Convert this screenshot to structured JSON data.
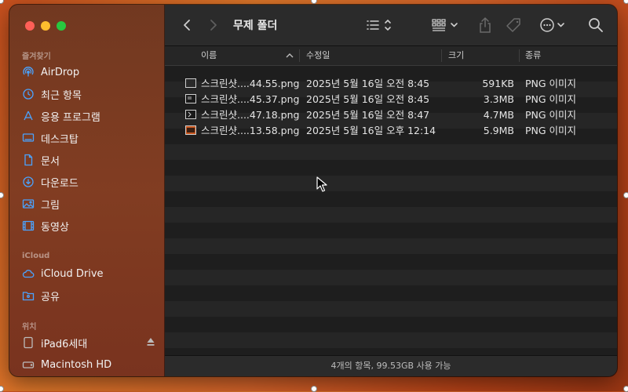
{
  "sidebar": {
    "sections": {
      "favorites": "즐겨찾기",
      "icloud": "iCloud",
      "locations": "위치"
    },
    "favorites": [
      {
        "label": "AirDrop",
        "icon": "airdrop-icon"
      },
      {
        "label": "최근 항목",
        "icon": "clock-icon"
      },
      {
        "label": "응용 프로그램",
        "icon": "applications-icon"
      },
      {
        "label": "데스크탑",
        "icon": "desktop-icon"
      },
      {
        "label": "문서",
        "icon": "document-icon"
      },
      {
        "label": "다운로드",
        "icon": "download-icon"
      },
      {
        "label": "그림",
        "icon": "pictures-icon"
      },
      {
        "label": "동영상",
        "icon": "movies-icon"
      }
    ],
    "icloud": [
      {
        "label": "iCloud Drive",
        "icon": "cloud-icon"
      },
      {
        "label": "공유",
        "icon": "shared-folder-icon"
      }
    ],
    "locations": [
      {
        "label": "iPad6세대",
        "icon": "ipad-icon"
      },
      {
        "label": "Macintosh HD",
        "icon": "harddrive-icon"
      }
    ]
  },
  "toolbar": {
    "title": "무제 폴더"
  },
  "columns": {
    "name": "이름",
    "modified": "수정일",
    "size": "크기",
    "kind": "종류"
  },
  "files": [
    {
      "name": "스크린샷....44.55.png",
      "modified": "2025년 5월 16일 오전 8:45",
      "size": "591KB",
      "kind": "PNG 이미지"
    },
    {
      "name": "스크린샷....45.37.png",
      "modified": "2025년 5월 16일 오전 8:45",
      "size": "3.3MB",
      "kind": "PNG 이미지"
    },
    {
      "name": "스크린샷....47.18.png",
      "modified": "2025년 5월 16일 오전 8:47",
      "size": "4.7MB",
      "kind": "PNG 이미지"
    },
    {
      "name": "스크린샷....13.58.png",
      "modified": "2025년 5월 16일 오후 12:14",
      "size": "5.9MB",
      "kind": "PNG 이미지"
    }
  ],
  "status": "4개의 항목, 99.53GB 사용 가능",
  "colors": {
    "accent": "#4aa3ff",
    "close": "#ff5f57",
    "minimize": "#febc2e",
    "maximize": "#28c840"
  }
}
